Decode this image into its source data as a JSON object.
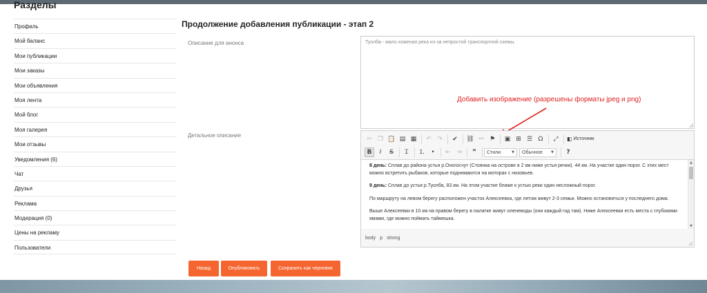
{
  "sidebar": {
    "title": "Разделы",
    "items": [
      {
        "label": "Профиль"
      },
      {
        "label": "Мой баланс"
      },
      {
        "label": "Мои публикации"
      },
      {
        "label": "Мои заказы"
      },
      {
        "label": "Мои объявления"
      },
      {
        "label": "Моя лента"
      },
      {
        "label": "Мой блог"
      },
      {
        "label": "Моя галерея"
      },
      {
        "label": "Мои отзывы"
      },
      {
        "label": "Уведомления (6)"
      },
      {
        "label": "Чат"
      },
      {
        "label": "Друзья"
      },
      {
        "label": "Реклама"
      },
      {
        "label": "Модерация (0)"
      },
      {
        "label": "Цены на рекламу"
      },
      {
        "label": "Пользователи"
      }
    ]
  },
  "main": {
    "title": "Продолжение добавления публикации - этап 2",
    "anons_label": "Описание для анонса",
    "anons_value": "Туолба - мало хоженая река из-за непростой транспортной схемы.",
    "detail_label": "Детальное описание",
    "annotation": "Добавить изображение (разрешены форматы jpeg и png)"
  },
  "editor": {
    "source_label": "Источник",
    "styles_select": "Стили",
    "format_select": "Обычное",
    "paragraphs": [
      {
        "bold": "8 день:",
        "text": " Сплав до района устья р.Оногосчут (Стоянка на острове в 2 км ниже устья речки). 44 км. На участке один порог. С этих мест можно встретить рыбаков, которые поднимаются на моторах с низовьев."
      },
      {
        "bold": "9 день:",
        "text": " Сплав до устья р.Туолба, 83 км. На этом участке ближе к устью реки один несложный порог."
      },
      {
        "bold": "",
        "text": "По маршруту на левом берегу расположен участок Алексеевка, где летом живут 2-3 семьи. Можно остановиться у последнего дома."
      },
      {
        "bold": "",
        "text": "Выше Алексеевки в 10 км на правом берегу в палатке живут оленеводы (они каждый год там). Ниже Алексеевки есть места с глубокими ямами, где можно поймать таймешка."
      }
    ],
    "path": [
      "body",
      "p",
      "strong"
    ]
  },
  "buttons": {
    "back": "Назад",
    "publish": "Опубликовать",
    "draft": "Сохранить как черновик"
  },
  "colors": {
    "accent": "#f4652f",
    "annotation": "#e02020"
  }
}
